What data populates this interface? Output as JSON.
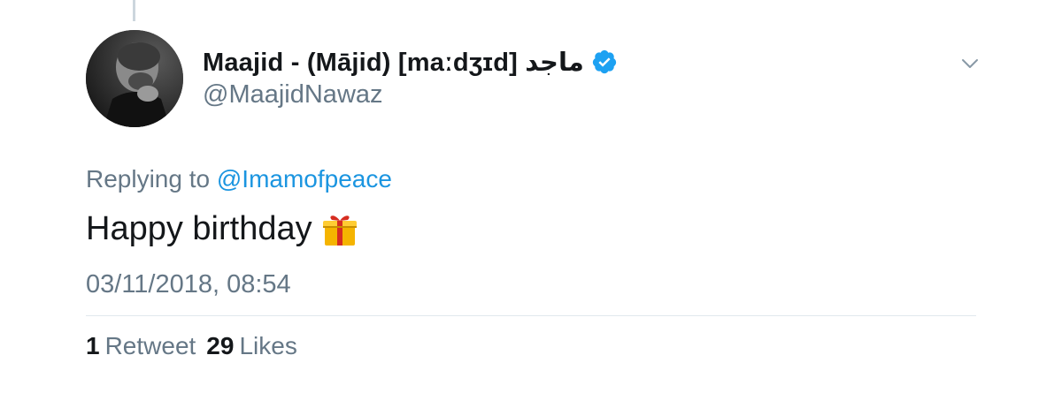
{
  "tweet": {
    "author": {
      "display_name": "Maajid - (Mājid) [maːdʒɪd] ماجد",
      "handle": "@MaajidNawaz",
      "verified": true
    },
    "replying_prefix": "Replying to",
    "replying_to": "@Imamofpeace",
    "text": "Happy birthday",
    "emoji_icon": "wrapped-gift-icon",
    "timestamp": "03/11/2018, 08:54",
    "stats": {
      "retweets_count": "1",
      "retweets_label": "Retweet",
      "likes_count": "29",
      "likes_label": "Likes"
    }
  },
  "colors": {
    "text": "#14171a",
    "secondary": "#657786",
    "link": "#1b95e0",
    "verified": "#1da1f2",
    "divider": "#e1e8ed",
    "thread_line": "#ccd6dd"
  }
}
